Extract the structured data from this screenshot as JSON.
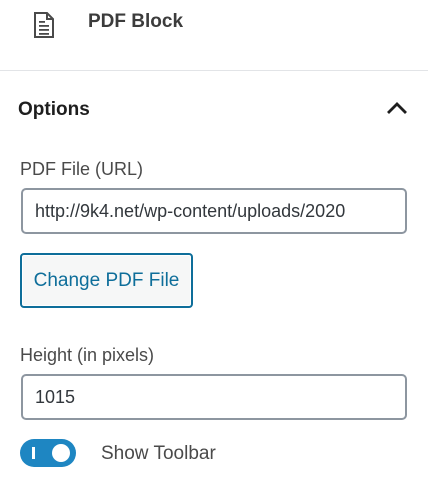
{
  "block": {
    "icon": "document-icon",
    "title": "PDF Block"
  },
  "options": {
    "title": "Options",
    "toggle_icon": "chevron-up-icon",
    "pdf_file": {
      "label": "PDF File (URL)",
      "value": "http://9k4.net/wp-content/uploads/2020"
    },
    "change_button": "Change PDF File",
    "height": {
      "label": "Height (in pixels)",
      "value": "1015"
    },
    "show_toolbar": {
      "label": "Show Toolbar",
      "enabled": true
    }
  },
  "colors": {
    "accent": "#0e6e9a",
    "toggle_on": "#1e86c2",
    "border": "#8d96a0",
    "divider": "#e2e4e7"
  }
}
